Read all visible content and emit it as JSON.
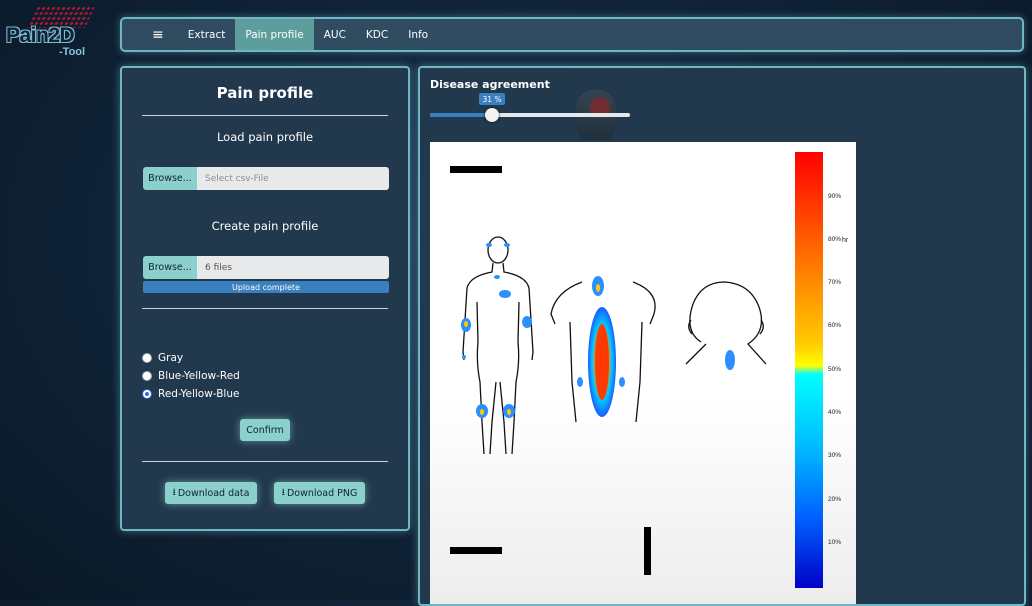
{
  "logo": {
    "name": "Pain2D",
    "sub": "-Tool"
  },
  "nav": {
    "menu_icon": "hamburger-icon",
    "items": [
      {
        "label": "Extract",
        "active": false
      },
      {
        "label": "Pain profile",
        "active": true
      },
      {
        "label": "AUC",
        "active": false
      },
      {
        "label": "KDC",
        "active": false
      },
      {
        "label": "Info",
        "active": false
      }
    ]
  },
  "left_panel": {
    "title": "Pain profile",
    "load": {
      "title": "Load pain profile",
      "browse_label": "Browse...",
      "placeholder": "Select csv-File"
    },
    "create": {
      "title": "Create pain profile",
      "browse_label": "Browse...",
      "value": "6 files",
      "progress_text": "Upload complete",
      "progress": 1.0
    },
    "color_schemes": [
      {
        "label": "Gray",
        "checked": false
      },
      {
        "label": "Blue-Yellow-Red",
        "checked": false
      },
      {
        "label": "Red-Yellow-Blue",
        "checked": true
      }
    ],
    "confirm_label": "Confirm",
    "download_data_label": "Download data",
    "download_png_label": "Download PNG",
    "download_icon": "download-icon"
  },
  "right_panel": {
    "slider_title": "Disease agreement",
    "slider_value_text": "31 %",
    "slider_value": 0.31
  },
  "colorbar": {
    "ticks": [
      "90%",
      "80%",
      "70%",
      "60%",
      "50%",
      "40%",
      "30%",
      "20%",
      "10%"
    ],
    "label": "hr",
    "colors": [
      "#ff0000",
      "#ff7d00",
      "#ffff00",
      "#00ffff",
      "#0060ff",
      "#0000c8"
    ]
  }
}
